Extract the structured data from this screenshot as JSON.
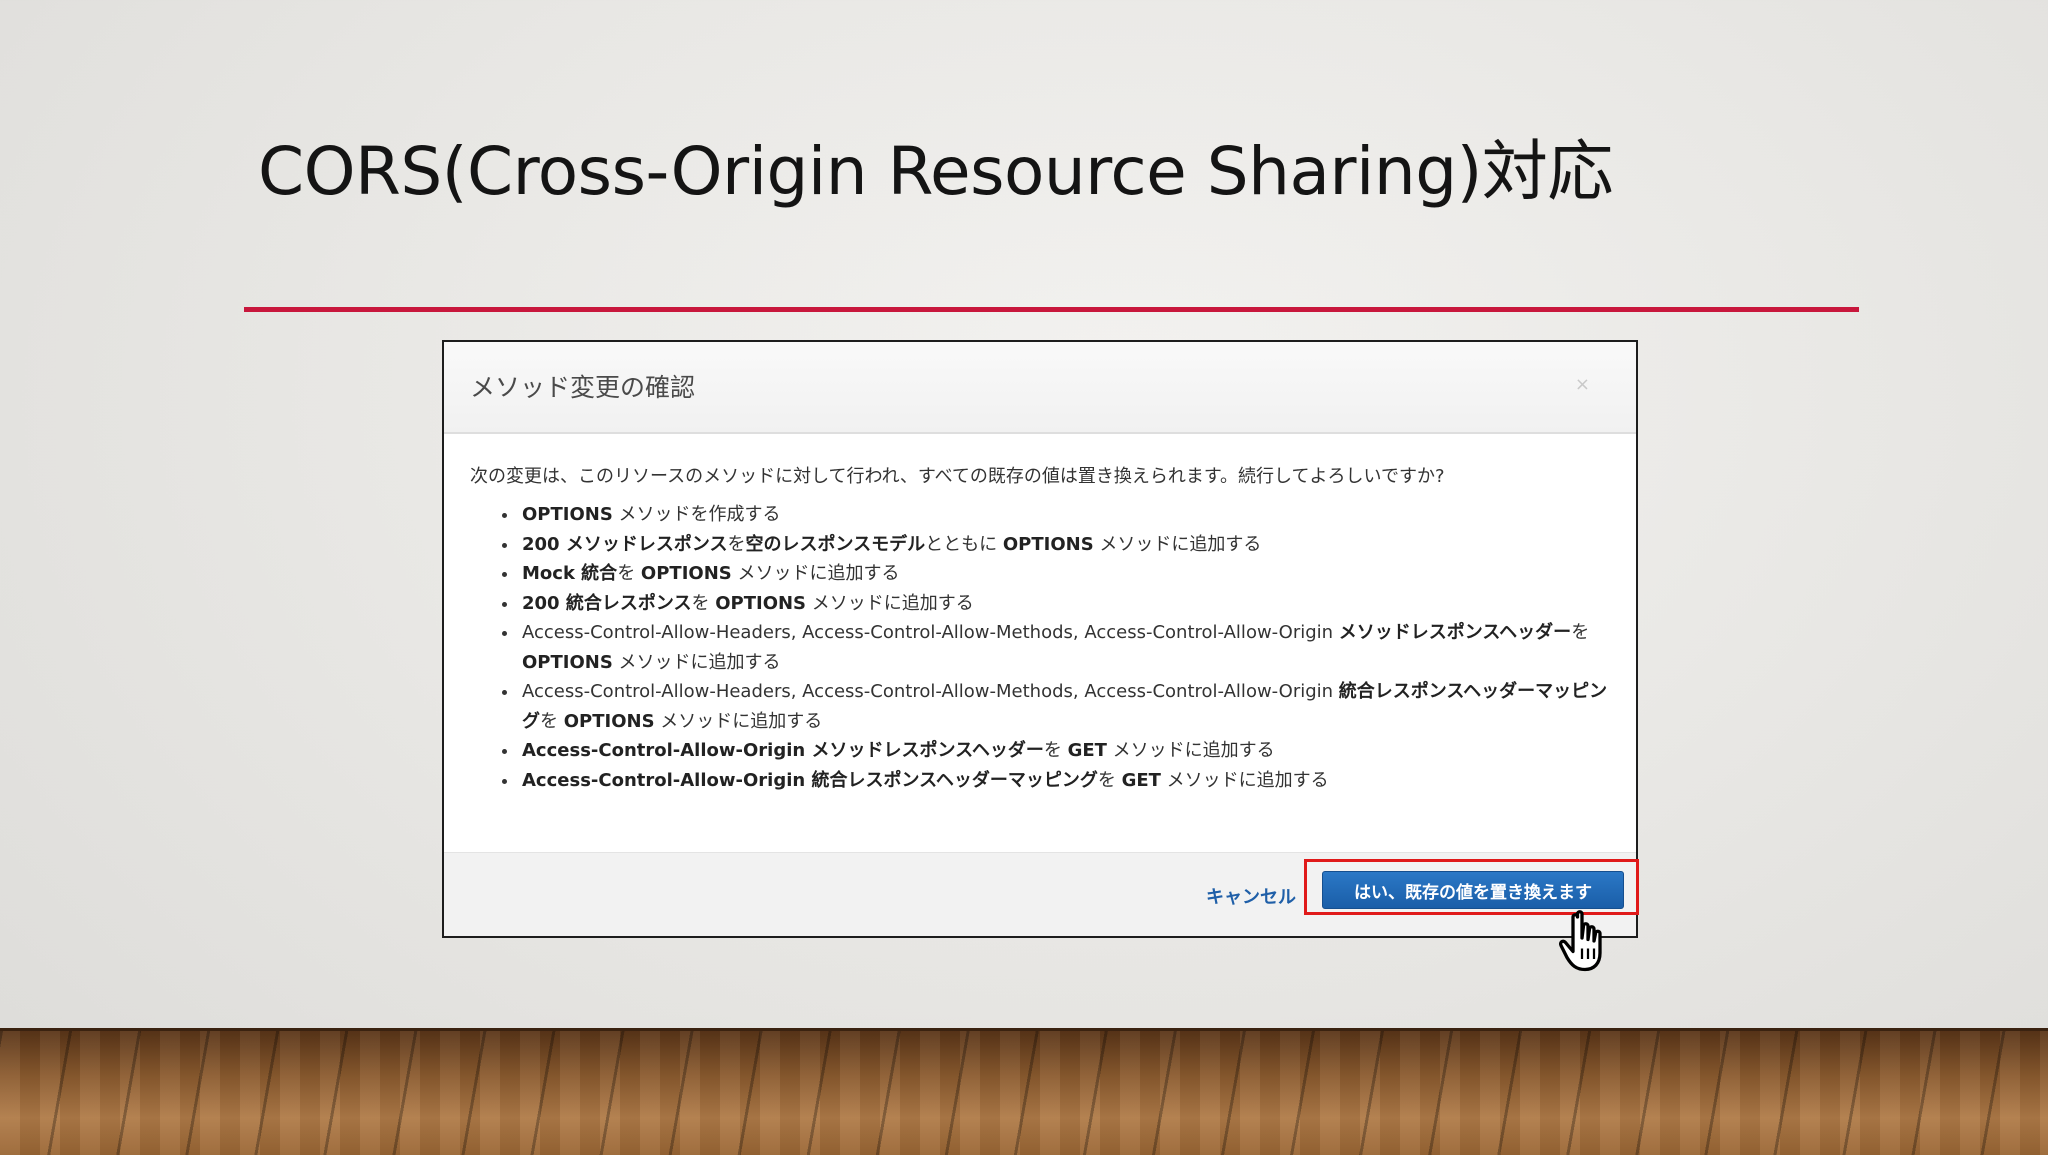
{
  "slide": {
    "title": "CORS(Cross-Origin Resource Sharing)対応"
  },
  "colors": {
    "accent_rule": "#c8173c",
    "primary_button": "#1a5ea8",
    "link": "#1f5fa8",
    "highlight": "#e01a1a"
  },
  "modal": {
    "title": "メソッド変更の確認",
    "close_icon": "×",
    "intro": "次の変更は、このリソースのメソッドに対して行われ、すべての既存の値は置き換えられます。続行してよろしいですか?",
    "items": [
      {
        "parts": [
          {
            "b": "OPTIONS"
          },
          {
            "t": " メソッドを作成する"
          }
        ]
      },
      {
        "parts": [
          {
            "b": "200 メソッドレスポンス"
          },
          {
            "t": "を"
          },
          {
            "b": "空のレスポンスモデル"
          },
          {
            "t": "とともに "
          },
          {
            "b": "OPTIONS"
          },
          {
            "t": " メソッドに追加する"
          }
        ]
      },
      {
        "parts": [
          {
            "b": "Mock 統合"
          },
          {
            "t": "を "
          },
          {
            "b": "OPTIONS"
          },
          {
            "t": " メソッドに追加する"
          }
        ]
      },
      {
        "parts": [
          {
            "b": "200 統合レスポンス"
          },
          {
            "t": "を "
          },
          {
            "b": "OPTIONS"
          },
          {
            "t": " メソッドに追加する"
          }
        ]
      },
      {
        "parts": [
          {
            "t": "Access-Control-Allow-Headers, Access-Control-Allow-Methods, Access-Control-Allow-Origin "
          },
          {
            "b": "メソッドレスポンスヘッダー"
          },
          {
            "t": "を "
          },
          {
            "b": "OPTIONS"
          },
          {
            "t": " メソッドに追加する"
          }
        ]
      },
      {
        "parts": [
          {
            "t": "Access-Control-Allow-Headers, Access-Control-Allow-Methods, Access-Control-Allow-Origin "
          },
          {
            "b": "統合レスポンスヘッダーマッピング"
          },
          {
            "t": "を "
          },
          {
            "b": "OPTIONS"
          },
          {
            "t": " メソッドに追加する"
          }
        ]
      },
      {
        "parts": [
          {
            "b": "Access-Control-Allow-Origin メソッドレスポンスヘッダー"
          },
          {
            "t": "を "
          },
          {
            "b": "GET"
          },
          {
            "t": " メソッドに追加する"
          }
        ]
      },
      {
        "parts": [
          {
            "b": "Access-Control-Allow-Origin 統合レスポンスヘッダーマッピング"
          },
          {
            "t": "を "
          },
          {
            "b": "GET"
          },
          {
            "t": " メソッドに追加する"
          }
        ]
      }
    ],
    "cancel_label": "キャンセル",
    "confirm_label": "はい、既存の値を置き換えます"
  },
  "cursor": {
    "icon": "hand-pointer-icon"
  }
}
